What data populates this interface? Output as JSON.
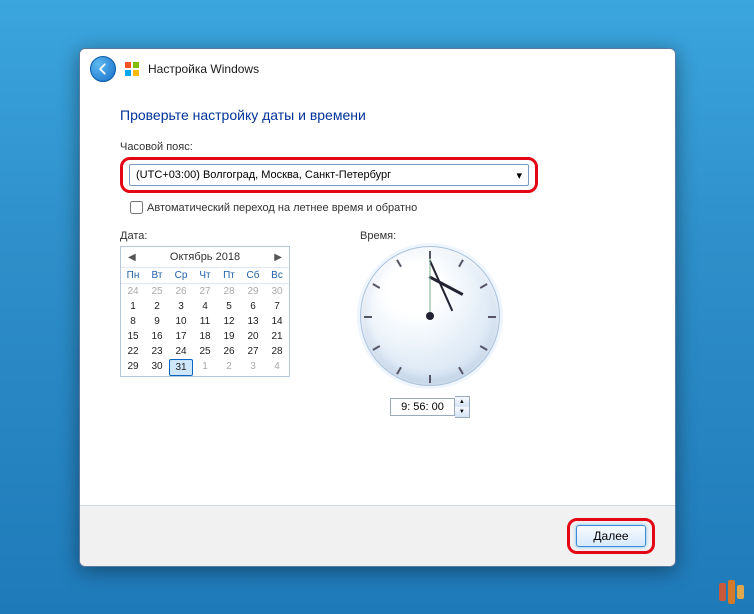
{
  "window": {
    "title": "Настройка Windows"
  },
  "page": {
    "heading": "Проверьте настройку даты и времени",
    "timezone_label": "Часовой пояс:",
    "timezone_selected": "(UTC+03:00) Волгоград, Москва, Санкт-Петербург",
    "dst_label": "Автоматический переход на летнее время и обратно",
    "date_label": "Дата:",
    "time_label": "Время:"
  },
  "calendar": {
    "month": "Октябрь 2018",
    "dow": [
      "Пн",
      "Вт",
      "Ср",
      "Чт",
      "Пт",
      "Сб",
      "Вс"
    ],
    "cells": [
      {
        "n": 24,
        "o": 1
      },
      {
        "n": 25,
        "o": 1
      },
      {
        "n": 26,
        "o": 1
      },
      {
        "n": 27,
        "o": 1
      },
      {
        "n": 28,
        "o": 1
      },
      {
        "n": 29,
        "o": 1
      },
      {
        "n": 30,
        "o": 1
      },
      {
        "n": 1
      },
      {
        "n": 2
      },
      {
        "n": 3
      },
      {
        "n": 4
      },
      {
        "n": 5
      },
      {
        "n": 6
      },
      {
        "n": 7
      },
      {
        "n": 8
      },
      {
        "n": 9
      },
      {
        "n": 10
      },
      {
        "n": 11
      },
      {
        "n": 12
      },
      {
        "n": 13
      },
      {
        "n": 14
      },
      {
        "n": 15
      },
      {
        "n": 16
      },
      {
        "n": 17
      },
      {
        "n": 18
      },
      {
        "n": 19
      },
      {
        "n": 20
      },
      {
        "n": 21
      },
      {
        "n": 22
      },
      {
        "n": 23
      },
      {
        "n": 24
      },
      {
        "n": 25
      },
      {
        "n": 26
      },
      {
        "n": 27
      },
      {
        "n": 28
      },
      {
        "n": 29
      },
      {
        "n": 30
      },
      {
        "n": 31,
        "s": 1
      },
      {
        "n": 1,
        "o": 1
      },
      {
        "n": 2,
        "o": 1
      },
      {
        "n": 3,
        "o": 1
      },
      {
        "n": 4,
        "o": 1
      }
    ]
  },
  "clock": {
    "time_text": "9: 56: 00"
  },
  "footer": {
    "next": "Далее"
  }
}
